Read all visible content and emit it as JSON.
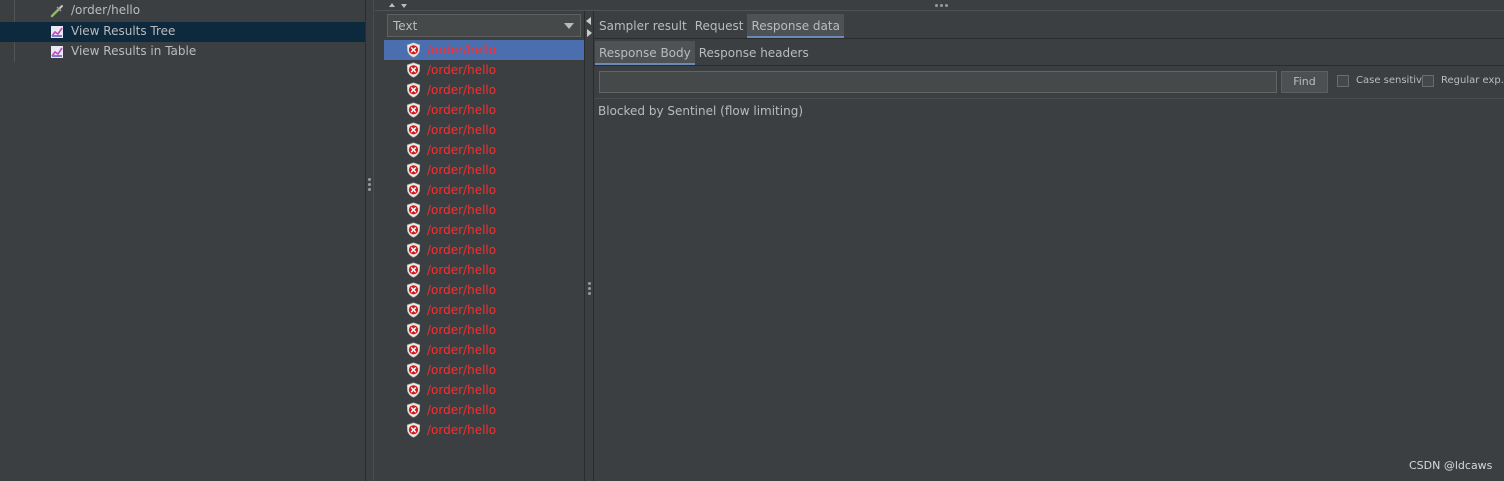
{
  "tree": {
    "items": [
      {
        "label": "/order/hello",
        "icon": "pipette-icon",
        "selected": false
      },
      {
        "label": "View Results Tree",
        "icon": "chart-icon",
        "selected": true
      },
      {
        "label": "View Results in Table",
        "icon": "chart-icon",
        "selected": false
      }
    ]
  },
  "renderer": {
    "selected": "Text"
  },
  "samples": {
    "items": [
      "/order/hello",
      "/order/hello",
      "/order/hello",
      "/order/hello",
      "/order/hello",
      "/order/hello",
      "/order/hello",
      "/order/hello",
      "/order/hello",
      "/order/hello",
      "/order/hello",
      "/order/hello",
      "/order/hello",
      "/order/hello",
      "/order/hello",
      "/order/hello",
      "/order/hello",
      "/order/hello",
      "/order/hello",
      "/order/hello"
    ],
    "selected_index": 0,
    "status_icon": "error-shield-icon",
    "text_color": "#ff2b2b"
  },
  "result_tabs": {
    "items": [
      "Sampler result",
      "Request",
      "Response data"
    ],
    "active": 2
  },
  "response_tabs": {
    "items": [
      "Response Body",
      "Response headers"
    ],
    "active": 0
  },
  "search": {
    "value": "",
    "find_label": "Find",
    "case_sensitive_label": "Case sensitive",
    "regex_label": "Regular exp.",
    "case_sensitive": false,
    "regex": false
  },
  "response_body": "Blocked by Sentinel (flow limiting)",
  "watermark": "CSDN @ldcaws",
  "colors": {
    "accent": "#4b6eaf",
    "tree_selected": "#0d293e",
    "error": "#ff2b2b"
  }
}
